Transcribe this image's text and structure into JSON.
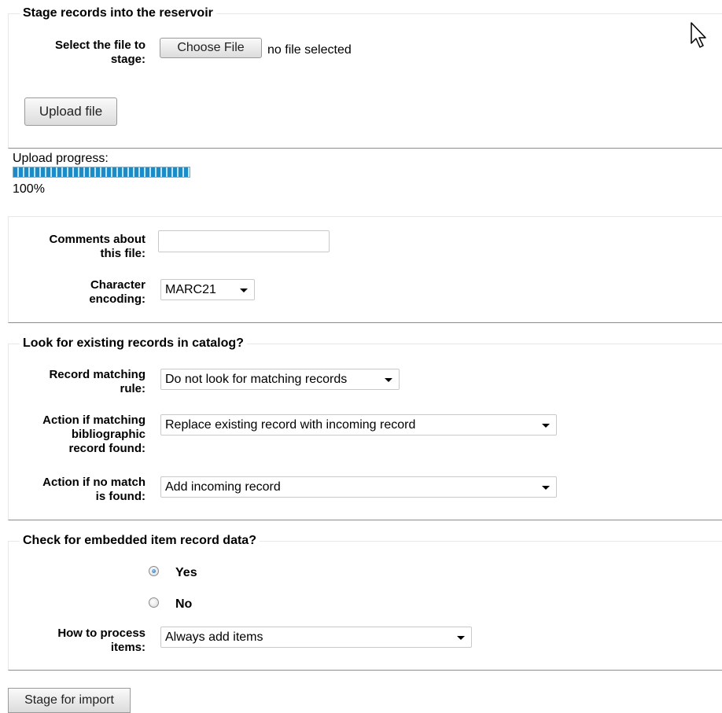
{
  "stage": {
    "legend": "Stage records into the reservoir",
    "file_label_1": "Select the file to",
    "file_label_2": "stage:",
    "choose_file_button": "Choose File",
    "file_status": "no file selected",
    "upload_button": "Upload file"
  },
  "progress": {
    "label": "Upload progress:",
    "percent_text": "100%",
    "fraction": 1.0
  },
  "file_options": {
    "comments_label_1": "Comments about",
    "comments_label_2": "this file:",
    "comments_value": "",
    "encoding_label_1": "Character",
    "encoding_label_2": "encoding:",
    "encoding_value": "MARC21"
  },
  "matching": {
    "legend": "Look for existing records in catalog?",
    "rule_label_1": "Record matching",
    "rule_label_2": "rule:",
    "rule_value": "Do not look for matching records",
    "found_label_1": "Action if matching",
    "found_label_2": "bibliographic",
    "found_label_3": "record found:",
    "found_value": "Replace existing record with incoming record",
    "nomatch_label_1": "Action if no match",
    "nomatch_label_2": "is found:",
    "nomatch_value": "Add incoming record"
  },
  "items": {
    "legend": "Check for embedded item record data?",
    "yes_label": "Yes",
    "no_label": "No",
    "yes_checked": true,
    "process_label_1": "How to process",
    "process_label_2": "items:",
    "process_value": "Always add items"
  },
  "submit": {
    "stage_button": "Stage for import"
  },
  "icons": {
    "cursor": "mouse-pointer-icon",
    "dropdown": "chevron-down-icon"
  },
  "colors": {
    "progress_fill": "#2a97cf",
    "radio_selected": "#1a5fa8"
  }
}
